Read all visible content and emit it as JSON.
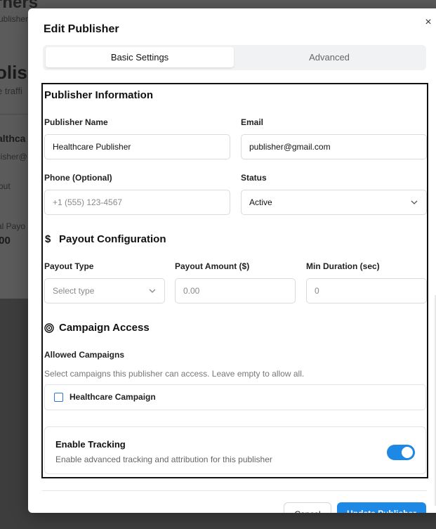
{
  "background": {
    "heading": "rners",
    "subheading": "ublisher",
    "page_title": "olish",
    "page_subtitle": "e traffi",
    "row_name": "althca",
    "row_email": "lisher@",
    "row_payout_label": "out",
    "row_payout_type": "al Payo",
    "row_amount": ".00"
  },
  "modal": {
    "title": "Edit Publisher",
    "close_glyph": "×",
    "tabs": [
      {
        "label": "Basic Settings",
        "active": true
      },
      {
        "label": "Advanced",
        "active": false
      }
    ],
    "publisher_info": {
      "title": "Publisher Information",
      "name_label": "Publisher Name",
      "name_value": "Healthcare Publisher",
      "email_label": "Email",
      "email_value": "publisher@gmail.com",
      "phone_label": "Phone (Optional)",
      "phone_placeholder": "+1 (555) 123-4567",
      "status_label": "Status",
      "status_value": "Active"
    },
    "payout": {
      "title": "Payout Configuration",
      "icon_glyph": "$",
      "type_label": "Payout Type",
      "type_placeholder": "Select type",
      "amount_label": "Payout Amount ($)",
      "amount_placeholder": "0.00",
      "duration_label": "Min Duration (sec)",
      "duration_placeholder": "0"
    },
    "campaign_access": {
      "title": "Campaign Access",
      "allowed_label": "Allowed Campaigns",
      "helper": "Select campaigns this publisher can access. Leave empty to allow all.",
      "campaigns": [
        {
          "label": "Healthcare Campaign",
          "checked": false
        }
      ]
    },
    "tracking": {
      "title": "Enable Tracking",
      "description": "Enable advanced tracking and attribution for this publisher",
      "enabled": true
    },
    "footer": {
      "cancel_label": "Cancel",
      "update_label": "Update Publisher"
    }
  },
  "colors": {
    "accent": "#1e88e5",
    "checkbox_border": "#2b74d8"
  }
}
